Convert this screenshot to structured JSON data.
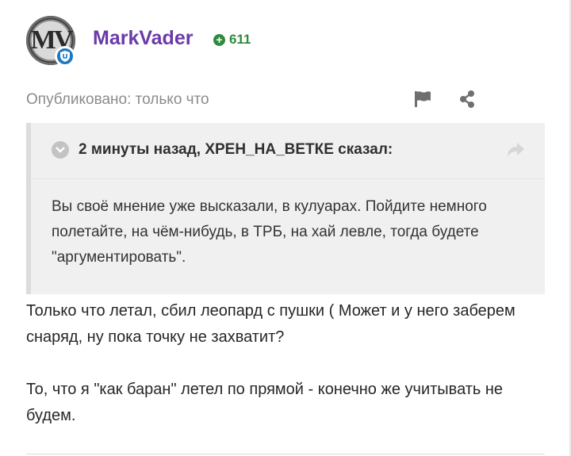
{
  "author": {
    "avatar_text": "MV",
    "username": "MarkVader",
    "reputation": "611",
    "reputation_icon": "plus-circle-icon",
    "badge_icon": "shield-icon",
    "username_color": "#6b3aa8",
    "reputation_color": "#2e8b3d"
  },
  "meta": {
    "published": "Опубликовано: только что",
    "report_icon": "flag-icon",
    "share_icon": "share-icon"
  },
  "quote": {
    "citation": "2 минуты назад, ХРЕН_НА_ВЕТКЕ сказал:",
    "toggle_icon": "chevron-down-icon",
    "goto_icon": "forward-arrow-icon",
    "text": "Вы своё мнение уже высказали, в кулуарах. Пойдите немного полетайте, на чём-нибудь, в ТРБ, на хай левле, тогда будете \"аргументировать\"."
  },
  "post": {
    "paragraphs": [
      "Только что летал, сбил леопард с пушки ( Может и у него заберем снаряд, ну пока точку не захватит?",
      "То, что я \"как баран\" летел по прямой - конечно же учитывать не будем."
    ]
  }
}
